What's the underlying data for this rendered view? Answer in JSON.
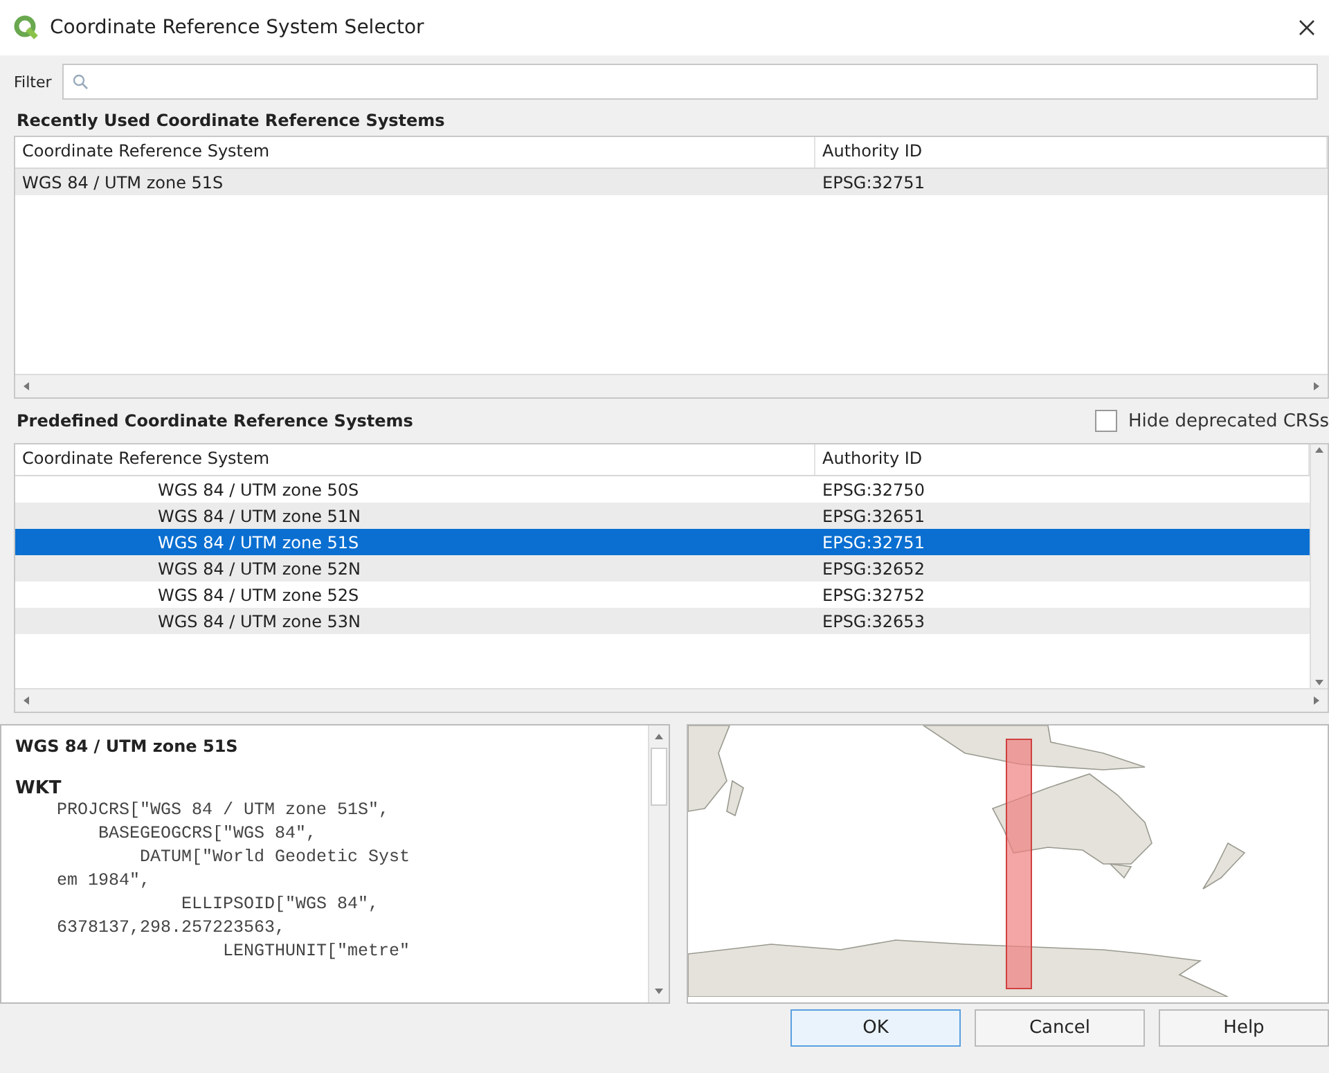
{
  "window": {
    "title": "Coordinate Reference System Selector"
  },
  "filter": {
    "label": "Filter"
  },
  "recent": {
    "heading": "Recently Used Coordinate Reference Systems",
    "columns": [
      "Coordinate Reference System",
      "Authority ID"
    ],
    "rows": [
      {
        "name": "WGS 84 / UTM zone 51S",
        "authority_id": "EPSG:32751",
        "selected": false
      }
    ]
  },
  "predefined": {
    "heading": "Predefined Coordinate Reference Systems",
    "hide_deprecated": {
      "label": "Hide deprecated CRSs",
      "checked": false
    },
    "columns": [
      "Coordinate Reference System",
      "Authority ID"
    ],
    "rows": [
      {
        "name": "WGS 84 / UTM zone 50S",
        "authority_id": "EPSG:32750",
        "selected": false
      },
      {
        "name": "WGS 84 / UTM zone 51N",
        "authority_id": "EPSG:32651",
        "selected": false
      },
      {
        "name": "WGS 84 / UTM zone 51S",
        "authority_id": "EPSG:32751",
        "selected": true
      },
      {
        "name": "WGS 84 / UTM zone 52N",
        "authority_id": "EPSG:32652",
        "selected": false
      },
      {
        "name": "WGS 84 / UTM zone 52S",
        "authority_id": "EPSG:32752",
        "selected": false
      },
      {
        "name": "WGS 84 / UTM zone 53N",
        "authority_id": "EPSG:32653",
        "selected": false
      }
    ]
  },
  "details": {
    "title": "WGS 84 / UTM zone 51S",
    "wkt_label": "WKT",
    "wkt_lines": [
      "    PROJCRS[\"WGS 84 / UTM zone 51S\",",
      "        BASEGEOGCRS[\"WGS 84\",",
      "            DATUM[\"World Geodetic Syst",
      "    em 1984\",",
      "                ELLIPSOID[\"WGS 84\",",
      "    6378137,298.257223563,",
      "                    LENGTHUNIT[\"metre\""
    ]
  },
  "buttons": [
    "OK",
    "Cancel",
    "Help"
  ]
}
